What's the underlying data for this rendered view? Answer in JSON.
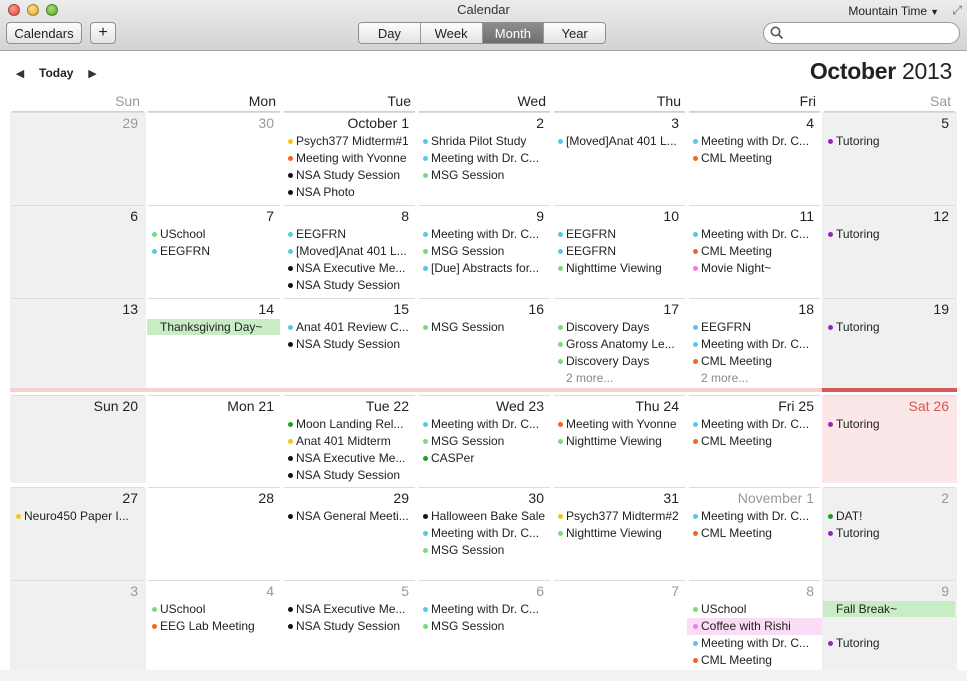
{
  "window": {
    "title": "Calendar",
    "timezone": "Mountain Time"
  },
  "toolbar": {
    "calendars_label": "Calendars",
    "add_label": "+",
    "views": [
      {
        "label": "Day",
        "selected": false
      },
      {
        "label": "Week",
        "selected": false
      },
      {
        "label": "Month",
        "selected": true
      },
      {
        "label": "Year",
        "selected": false
      }
    ],
    "search": {
      "value": "",
      "placeholder": ""
    }
  },
  "nav": {
    "prev": "◀",
    "today_label": "Today",
    "next": "▶"
  },
  "month_title": {
    "month": "October",
    "year": "2013"
  },
  "weekdays": [
    "Sun",
    "Mon",
    "Tue",
    "Wed",
    "Thu",
    "Fri",
    "Sat"
  ],
  "colors": {
    "purple": "#9b26b6",
    "blue": "#5bc6e8",
    "orange": "#f26522",
    "black": "#111111",
    "yellow": "#f5c518",
    "green": "#77dd77",
    "dgreen": "#1fa01f",
    "pink": "#f07de0",
    "allday_green": "#c8ecc4",
    "allday_pink": "#fbdcf6",
    "today_red": "#d35b57"
  },
  "weeks": [
    [
      {
        "label": "29",
        "dim": true,
        "events": []
      },
      {
        "label": "30",
        "dim": true,
        "events": []
      },
      {
        "label": "October 1",
        "events": [
          {
            "t": "Psych377 Midterm#1",
            "c": "yellow"
          },
          {
            "t": "Meeting with Yvonne",
            "c": "orange"
          },
          {
            "t": "NSA Study Session",
            "c": "black"
          },
          {
            "t": "NSA Photo",
            "c": "black"
          }
        ]
      },
      {
        "label": "2",
        "events": [
          {
            "t": "Shrida Pilot Study",
            "c": "blue"
          },
          {
            "t": "Meeting with Dr. C...",
            "c": "blue"
          },
          {
            "t": "MSG Session",
            "c": "green"
          }
        ]
      },
      {
        "label": "3",
        "events": [
          {
            "t": "[Moved]Anat 401 L...",
            "c": "blue"
          }
        ]
      },
      {
        "label": "4",
        "events": [
          {
            "t": "Meeting with Dr. C...",
            "c": "blue"
          },
          {
            "t": "CML Meeting",
            "c": "orange"
          }
        ]
      },
      {
        "label": "5",
        "events": [
          {
            "t": "Tutoring",
            "c": "purple"
          }
        ]
      }
    ],
    [
      {
        "label": "6",
        "events": []
      },
      {
        "label": "7",
        "events": [
          {
            "t": "USchool",
            "c": "green"
          },
          {
            "t": "EEGFRN",
            "c": "blue"
          }
        ]
      },
      {
        "label": "8",
        "events": [
          {
            "t": "EEGFRN",
            "c": "blue"
          },
          {
            "t": "[Moved]Anat 401 L...",
            "c": "blue"
          },
          {
            "t": "NSA Executive Me...",
            "c": "black"
          },
          {
            "t": "NSA Study Session",
            "c": "black"
          }
        ]
      },
      {
        "label": "9",
        "events": [
          {
            "t": "Meeting with Dr. C...",
            "c": "blue"
          },
          {
            "t": "MSG Session",
            "c": "green"
          },
          {
            "t": "[Due] Abstracts for...",
            "c": "blue"
          }
        ]
      },
      {
        "label": "10",
        "events": [
          {
            "t": "EEGFRN",
            "c": "blue"
          },
          {
            "t": "EEGFRN",
            "c": "blue"
          },
          {
            "t": "Nighttime Viewing",
            "c": "green"
          }
        ]
      },
      {
        "label": "11",
        "events": [
          {
            "t": "Meeting with Dr. C...",
            "c": "blue"
          },
          {
            "t": "CML Meeting",
            "c": "orange"
          },
          {
            "t": "Movie Night~",
            "c": "pink"
          }
        ]
      },
      {
        "label": "12",
        "events": [
          {
            "t": "Tutoring",
            "c": "purple"
          }
        ]
      }
    ],
    [
      {
        "label": "13",
        "events": []
      },
      {
        "label": "14",
        "allday": {
          "t": "Thanksgiving Day~",
          "c": "allday_green"
        },
        "events": []
      },
      {
        "label": "15",
        "events": [
          {
            "t": "Anat 401 Review C...",
            "c": "blue"
          },
          {
            "t": "NSA Study Session",
            "c": "black"
          }
        ]
      },
      {
        "label": "16",
        "events": [
          {
            "t": "MSG Session",
            "c": "green"
          }
        ]
      },
      {
        "label": "17",
        "events": [
          {
            "t": "Discovery Days",
            "c": "green"
          },
          {
            "t": "Gross Anatomy Le...",
            "c": "green"
          },
          {
            "t": "Discovery Days",
            "c": "green"
          }
        ],
        "more": "2 more..."
      },
      {
        "label": "18",
        "events": [
          {
            "t": "EEGFRN",
            "c": "blue"
          },
          {
            "t": "Meeting with Dr. C...",
            "c": "blue"
          },
          {
            "t": "CML Meeting",
            "c": "orange"
          }
        ],
        "more": "2 more..."
      },
      {
        "label": "19",
        "events": [
          {
            "t": "Tutoring",
            "c": "purple"
          }
        ]
      }
    ],
    [
      {
        "label": "Sun 20",
        "events": []
      },
      {
        "label": "Mon 21",
        "events": []
      },
      {
        "label": "Tue 22",
        "events": [
          {
            "t": "Moon Landing Rel...",
            "c": "dgreen"
          },
          {
            "t": "Anat 401 Midterm",
            "c": "yellow"
          },
          {
            "t": "NSA Executive Me...",
            "c": "black"
          },
          {
            "t": "NSA Study Session",
            "c": "black"
          }
        ]
      },
      {
        "label": "Wed 23",
        "events": [
          {
            "t": "Meeting with Dr. C...",
            "c": "blue"
          },
          {
            "t": "MSG Session",
            "c": "green"
          },
          {
            "t": "CASPer",
            "c": "dgreen"
          }
        ]
      },
      {
        "label": "Thu 24",
        "events": [
          {
            "t": "Meeting with Yvonne",
            "c": "orange"
          },
          {
            "t": "Nighttime Viewing",
            "c": "green"
          }
        ]
      },
      {
        "label": "Fri 25",
        "events": [
          {
            "t": "Meeting with Dr. C...",
            "c": "blue"
          },
          {
            "t": "CML Meeting",
            "c": "orange"
          }
        ]
      },
      {
        "label": "Sat 26",
        "today": true,
        "events": [
          {
            "t": "Tutoring",
            "c": "purple"
          }
        ]
      }
    ],
    [
      {
        "label": "27",
        "events": [
          {
            "t": "Neuro450 Paper I...",
            "c": "yellow"
          }
        ]
      },
      {
        "label": "28",
        "events": []
      },
      {
        "label": "29",
        "events": [
          {
            "t": "NSA General Meeti...",
            "c": "black"
          }
        ]
      },
      {
        "label": "30",
        "events": [
          {
            "t": "Halloween Bake Sale",
            "c": "black"
          },
          {
            "t": "Meeting with Dr. C...",
            "c": "blue"
          },
          {
            "t": "MSG Session",
            "c": "green"
          }
        ]
      },
      {
        "label": "31",
        "events": [
          {
            "t": "Psych377 Midterm#2",
            "c": "yellow"
          },
          {
            "t": "Nighttime Viewing",
            "c": "green"
          }
        ]
      },
      {
        "label": "November 1",
        "dim": true,
        "events": [
          {
            "t": "Meeting with Dr. C...",
            "c": "blue"
          },
          {
            "t": "CML Meeting",
            "c": "orange"
          }
        ]
      },
      {
        "label": "2",
        "dim": true,
        "events": [
          {
            "t": "DAT!",
            "c": "dgreen"
          },
          {
            "t": "Tutoring",
            "c": "purple"
          }
        ]
      }
    ],
    [
      {
        "label": "3",
        "dim": true,
        "events": []
      },
      {
        "label": "4",
        "dim": true,
        "events": [
          {
            "t": "USchool",
            "c": "green"
          },
          {
            "t": "EEG Lab Meeting",
            "c": "orange"
          }
        ]
      },
      {
        "label": "5",
        "dim": true,
        "events": [
          {
            "t": "NSA Executive Me...",
            "c": "black"
          },
          {
            "t": "NSA Study Session",
            "c": "black"
          }
        ]
      },
      {
        "label": "6",
        "dim": true,
        "events": [
          {
            "t": "Meeting with Dr. C...",
            "c": "blue"
          },
          {
            "t": "MSG Session",
            "c": "green"
          }
        ]
      },
      {
        "label": "7",
        "dim": true,
        "events": []
      },
      {
        "label": "8",
        "dim": true,
        "events": [
          {
            "t": "USchool",
            "c": "green"
          },
          {
            "t": "Coffee with Rishi",
            "c": "pink",
            "band": "allday_pink"
          },
          {
            "t": "Meeting with Dr. C...",
            "c": "blue"
          },
          {
            "t": "CML Meeting",
            "c": "orange"
          }
        ]
      },
      {
        "label": "9",
        "dim": true,
        "allday": {
          "t": "Fall Break~",
          "c": "allday_green"
        },
        "events": [
          {
            "gap": true
          },
          {
            "t": "Tutoring",
            "c": "purple"
          }
        ]
      }
    ]
  ]
}
